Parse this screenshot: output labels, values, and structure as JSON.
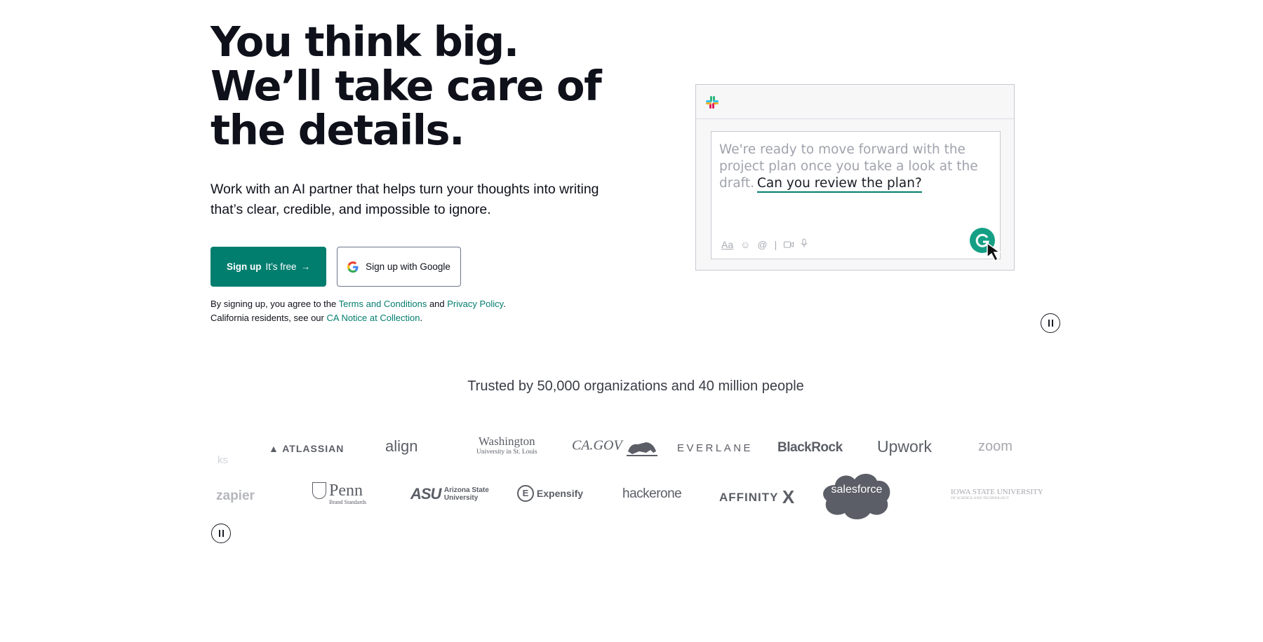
{
  "hero": {
    "headline": "You think big. We’ll take care of the details.",
    "subhead": "Work with an AI partner that helps turn your thoughts into writing that’s clear, credible, and impossible to ignore."
  },
  "cta": {
    "signup_bold": "Sign up",
    "signup_rest": "It’s free",
    "signup_arrow": "→",
    "google_label": "Sign up with Google"
  },
  "legal": {
    "line1_prefix": "By signing up, you agree to the ",
    "terms_link": "Terms and Conditions",
    "and": " and ",
    "privacy_link": "Privacy Policy",
    "line1_suffix": ".",
    "line2_prefix": "California residents, see our ",
    "ca_link": "CA Notice at Collection",
    "line2_suffix": "."
  },
  "demo": {
    "draft_text": "We're ready to move forward with the project plan once you take a look at the draft.",
    "suggestion": "Can you review the plan?",
    "toolbar_font": "Aa",
    "toolbar_divider": "|"
  },
  "trusted": {
    "heading": "Trusted by 50,000 organizations and 40 million people"
  },
  "logos_row1": [
    "ks",
    "ATLASSIAN",
    "align",
    "Washington",
    "University in St. Louis",
    "CA.GOV",
    "EVERLANE",
    "BlackRock",
    "Upwork",
    "zoom"
  ],
  "logos_row2": [
    "zapier",
    "Penn",
    "Brand Standards",
    "ASU",
    "Arizona State University",
    "Expensify",
    "hackerone",
    "AFFINITY",
    "X",
    "salesforce",
    "IOWA STATE UNIVERSITY",
    "OF SCIENCE AND TECHNOLOGY"
  ],
  "colors": {
    "brand": "#027e6f",
    "text": "#0e101a"
  }
}
